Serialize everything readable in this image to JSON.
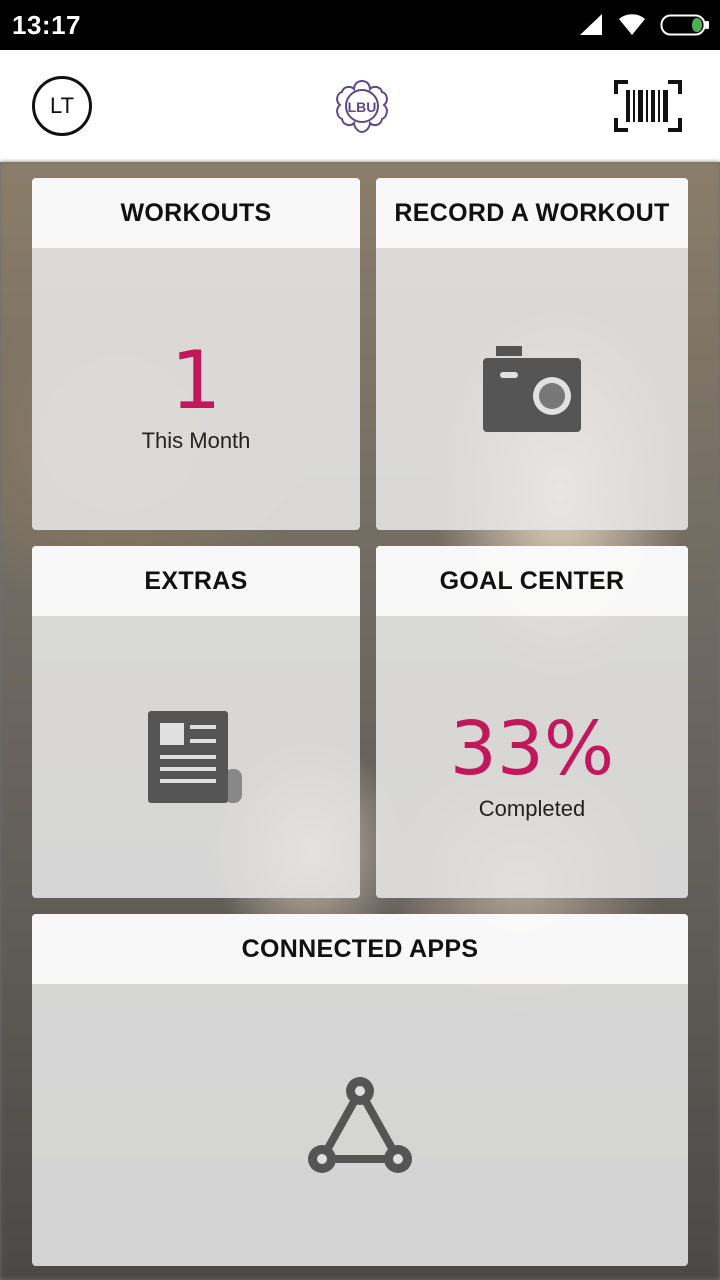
{
  "status_bar": {
    "time": "13:17",
    "icons": [
      "signal-icon",
      "wifi-icon",
      "battery-icon"
    ],
    "battery_color": "#4caf50"
  },
  "header": {
    "avatar_initials": "LT",
    "logo_text": "LBU",
    "logo_color": "#5b4a8b",
    "barcode_icon": "barcode-icon"
  },
  "accent_color": "#c2185b",
  "cards": {
    "workouts": {
      "title": "WORKOUTS",
      "value": "1",
      "caption": "This Month"
    },
    "record": {
      "title": "RECORD A WORKOUT",
      "icon": "camera-icon"
    },
    "extras": {
      "title": "EXTRAS",
      "icon": "newspaper-icon"
    },
    "goal": {
      "title": "GOAL CENTER",
      "value": "33%",
      "caption": "Completed"
    },
    "apps": {
      "title": "CONNECTED APPS",
      "icon": "connected-apps-icon"
    }
  }
}
